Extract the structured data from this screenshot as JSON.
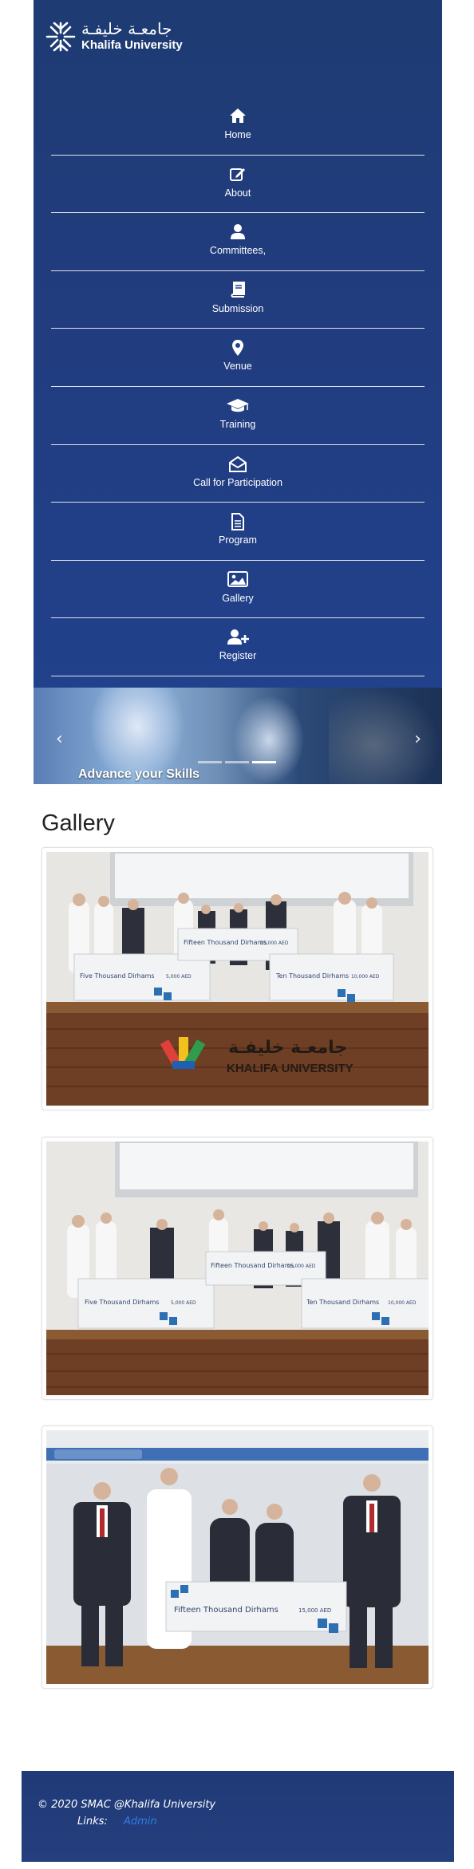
{
  "brand": {
    "arabic": "جامعـة خليفـة",
    "english": "Khalifa University"
  },
  "nav": [
    {
      "label": "Home",
      "icon": "home-icon"
    },
    {
      "label": "About",
      "icon": "edit-icon"
    },
    {
      "label": "Committees,",
      "icon": "user-icon"
    },
    {
      "label": "Submission",
      "icon": "book-icon"
    },
    {
      "label": "Venue",
      "icon": "map-marker-icon"
    },
    {
      "label": "Training",
      "icon": "graduation-cap-icon"
    },
    {
      "label": "Call for Participation",
      "icon": "envelope-open-icon"
    },
    {
      "label": "Program",
      "icon": "file-icon"
    },
    {
      "label": "Gallery",
      "icon": "image-icon"
    },
    {
      "label": "Register",
      "icon": "user-plus-icon"
    }
  ],
  "hero": {
    "caption": "Advance your Skills",
    "prev": "‹",
    "next": "›",
    "slides": 3,
    "active_slide": 3
  },
  "gallery": {
    "title": "Gallery",
    "photos": [
      {
        "checks": [
          "Five Thousand Dirhams",
          "Fifteen Thousand Dirhams",
          "Ten Thousand Dirhams"
        ],
        "amounts": [
          "5,000 AED",
          "15,000 AED",
          "10,000 AED"
        ],
        "sign": "KHALIFA UNIVERSITY",
        "sign_ar": "جامعـة خليفـة"
      },
      {
        "checks": [
          "Five Thousand Dirhams",
          "Fifteen Thousand Dirhams",
          "Ten Thousand Dirhams"
        ],
        "amounts": [
          "5,000 AED",
          "15,000 AED",
          "10,000 AED"
        ]
      },
      {
        "checks": [
          "Fifteen Thousand Dirhams"
        ],
        "amounts": [
          "15,000 AED"
        ]
      }
    ]
  },
  "footer": {
    "copyright": "© 2020 SMAC @Khalifa University",
    "links_label": "Links:",
    "admin_link": "Admin"
  },
  "colors": {
    "navy": "#21428f",
    "link": "#2f7de1",
    "ku_red": "#e0403a",
    "ku_yellow": "#f2c11d",
    "ku_green": "#2e9c4b",
    "ku_blue": "#1f5fb4"
  }
}
